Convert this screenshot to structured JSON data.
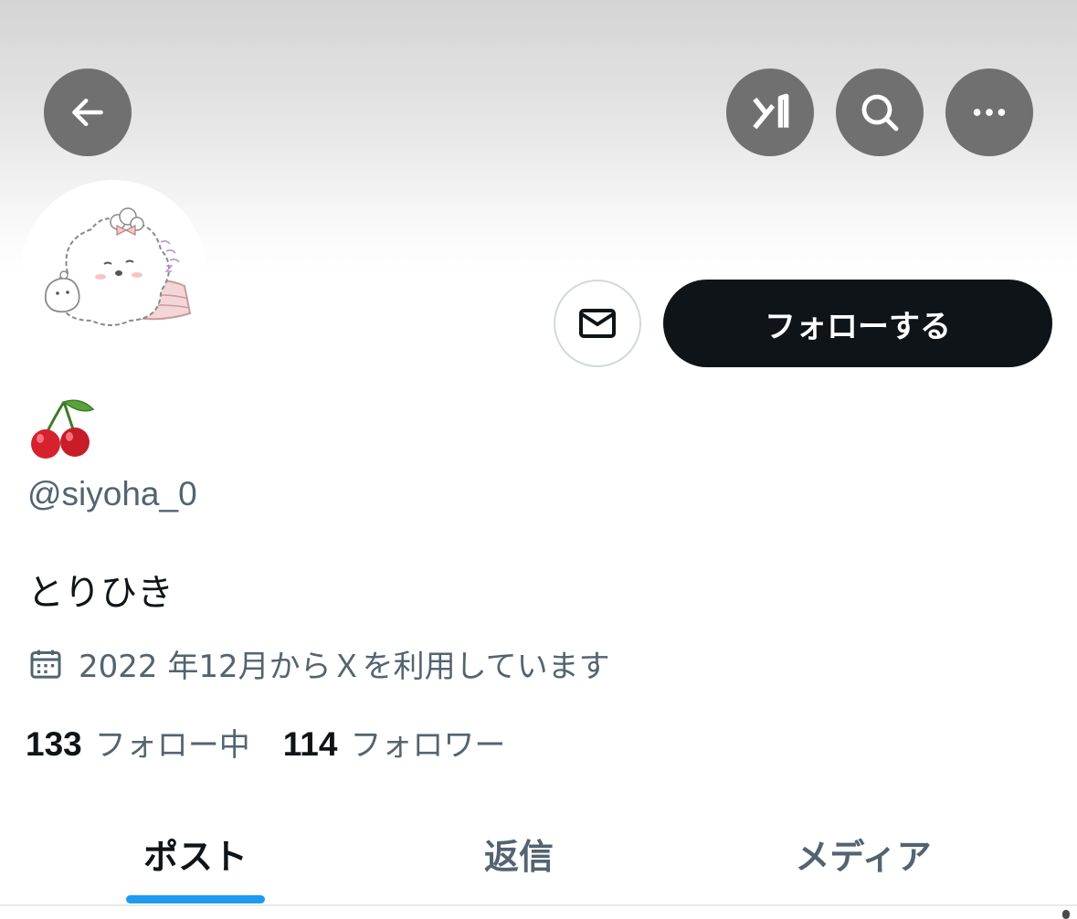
{
  "header": {
    "back_icon": "arrow-left-icon",
    "grok_icon": "grok-icon",
    "search_icon": "search-icon",
    "more_icon": "more-horizontal-icon"
  },
  "profile": {
    "avatar": "avatar-illustration",
    "display_name_emoji": "cherries",
    "handle": "@siyoha_0",
    "bio": "とりひき",
    "joined": "2022 年12月からＸを利用しています",
    "following_count": "133",
    "following_label": "フォロー中",
    "followers_count": "114",
    "followers_label": "フォロワー"
  },
  "actions": {
    "message_icon": "mail-icon",
    "follow_label": "フォローする"
  },
  "tabs": [
    {
      "label": "ポスト",
      "active": true
    },
    {
      "label": "返信",
      "active": false
    },
    {
      "label": "メディア",
      "active": false
    }
  ],
  "colors": {
    "accent": "#1d9bf0",
    "primary_text": "#0f1419",
    "secondary_text": "#536471",
    "button_dark": "#0f1419",
    "overlay_button": "#707070"
  }
}
